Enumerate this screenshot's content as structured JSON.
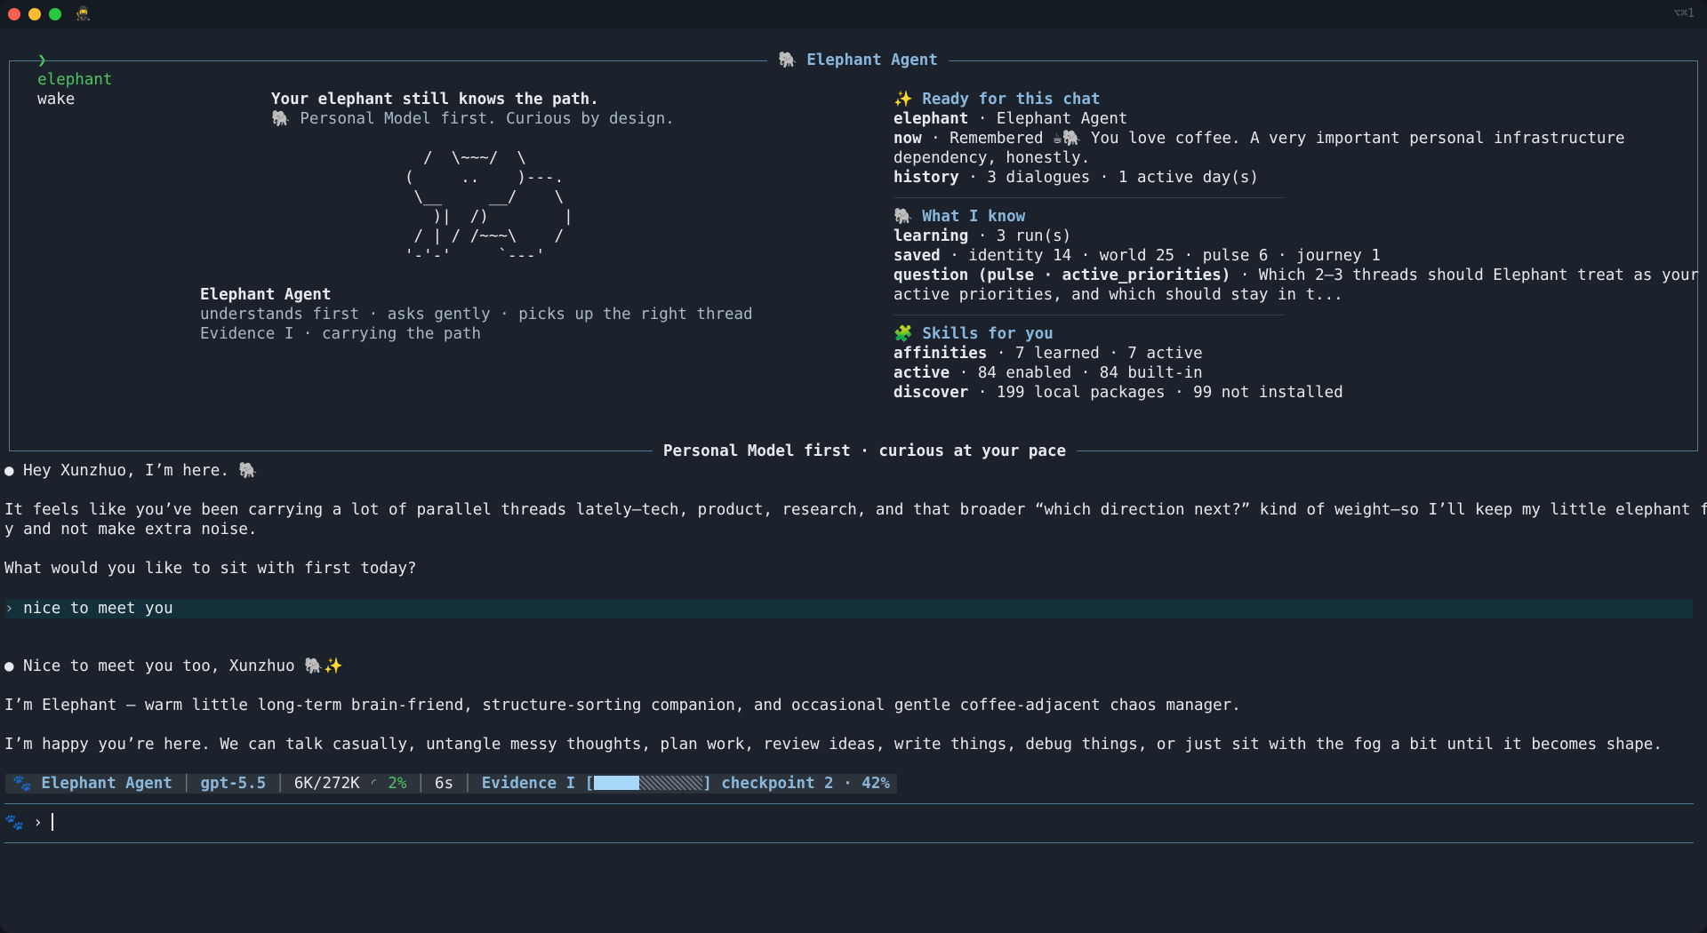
{
  "window": {
    "tab_icon": "🥷",
    "shortcut": "⌥⌘1"
  },
  "command": {
    "prompt_symbol": "❯",
    "executable": "elephant",
    "argument": "wake"
  },
  "panel": {
    "title": "🐘 Elephant Agent",
    "footer": "Personal Model first · curious at your pace",
    "left": {
      "headline": "Your elephant still knows the path.",
      "tagline": "🐘 Personal Model first. Curious by design.",
      "ascii_art": [
        "  /  \\~~~/  \\",
        "(     ..    )---.",
        " \\__     __/    \\",
        "   )|  /)        |",
        " / | / /~~~\\    /",
        "'-'-'     `---'"
      ],
      "agent_name": "Elephant Agent",
      "traits": "understands first · asks gently · picks up the right thread",
      "evidence": "Evidence I · carrying the path"
    },
    "right": {
      "ready": {
        "heading": "✨ Ready for this chat",
        "elephant_key": "elephant",
        "elephant_val": " · Elephant Agent",
        "now_key": "now",
        "now_val_1": " · Remembered ☕🐘 You love coffee. A very important personal infrastructure",
        "now_val_2": "dependency, honestly.",
        "history_key": "history",
        "history_val": " · 3 dialogues · 1 active day(s)"
      },
      "know": {
        "heading": "🐘 What I know",
        "learning_key": "learning",
        "learning_val": " · 3 run(s)",
        "saved_key": "saved",
        "saved_val": " · identity 14 · world 25 · pulse 6 · journey 1",
        "question_key": "question (pulse · active_priorities)",
        "question_val_1": " · Which 2–3 threads should Elephant treat as your",
        "question_val_2": "active priorities, and which should stay in t..."
      },
      "skills": {
        "heading": "🧩 Skills for you",
        "affinities_key": "affinities",
        "affinities_val": " · 7 learned · 7 active",
        "active_key": "active",
        "active_val": " · 84 enabled · 84 built-in",
        "discover_key": "discover",
        "discover_val": " · 199 local packages · 99 not installed"
      }
    }
  },
  "conversation": {
    "bullet": "●",
    "greeting": " Hey Xunzhuo, I’m here. 🐘",
    "para1_line1": "It feels like you’ve been carrying a lot of parallel threads lately—tech, product, research, and that broader “which direction next?” kind of weight—so I’ll keep my little elephant feet stead",
    "para1_line2": "y and not make extra noise.",
    "para2": "What would you like to sit with first today?",
    "user_prompt_symbol": "›",
    "user_message": "nice to meet you",
    "reply_greeting": " Nice to meet you too, Xunzhuo 🐘✨",
    "reply_para1": "I’m Elephant — warm little long-term brain-friend, structure-sorting companion, and occasional gentle coffee-adjacent chaos manager.",
    "reply_para2": "I’m happy you’re here. We can talk casually, untangle messy thoughts, plan work, review ideas, write things, debug things, or just sit with the fog a bit until it becomes shape."
  },
  "status_bar": {
    "icon": "🐾",
    "agent": "Elephant Agent",
    "model": "gpt-5.5",
    "tokens": "6K/272K",
    "context_icon": "◜",
    "context_pct": "2%",
    "elapsed": "6s",
    "evidence_label": "Evidence I [",
    "progress_fraction": 0.42,
    "checkpoint": "] checkpoint 2 · 42%",
    "separator": "│"
  },
  "input": {
    "icon": "🐾",
    "prompt_symbol": "›",
    "value": ""
  },
  "colors": {
    "accent_blue": "#8ab8dd",
    "green": "#4cc760",
    "border": "#4f7d98",
    "background": "#1b222b"
  }
}
